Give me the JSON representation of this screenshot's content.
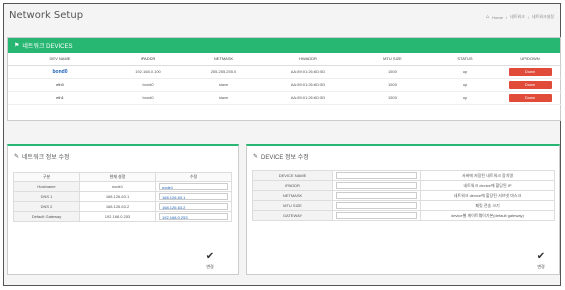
{
  "header": {
    "title": "Network Setup",
    "breadcrumb": [
      "Home",
      "네트워크",
      "네트워크설정"
    ],
    "home_icon": "home-icon"
  },
  "devices": {
    "title": "네트워크 DEVICES",
    "icon": "bookmark-icon",
    "columns": [
      "DEV NAME",
      "IPADDR",
      "NETMASK",
      "HWADDR",
      "MTU SIZE",
      "STATUS",
      "UP/DOWN"
    ],
    "rows": [
      {
        "name": "bond0",
        "ipaddr": "192.168.0.100",
        "netmask": "255.255.255.0",
        "hwaddr": "AA:89:01:26:6D:5D",
        "mtu": "1500",
        "status": "up",
        "action": "Down"
      },
      {
        "name": "eth0",
        "ipaddr": "bond0",
        "netmask": "slave",
        "hwaddr": "AA:89:01:26:6D:5D",
        "mtu": "1500",
        "status": "up",
        "action": "Down"
      },
      {
        "name": "eth1",
        "ipaddr": "bond0",
        "netmask": "slave",
        "hwaddr": "AA:89:01:26:6D:5D",
        "mtu": "1500",
        "status": "up",
        "action": "Down"
      }
    ],
    "accent_color": "#27b772",
    "down_color": "#e04b3a"
  },
  "network_edit": {
    "title": "네트워크 정보 수정",
    "icon": "edit-icon",
    "columns": [
      "구분",
      "현재 설정",
      "수정"
    ],
    "rows": [
      {
        "label": "Hostname",
        "current": "node1",
        "value": "node1"
      },
      {
        "label": "DNS 1",
        "current": "168.126.63.1",
        "value": "168.126.63.1"
      },
      {
        "label": "DNS 2",
        "current": "168.126.63.2",
        "value": "168.126.63.2"
      },
      {
        "label": "Default Gateway",
        "current": "192.168.0.253",
        "value": "192.168.0.253"
      }
    ],
    "save_label": "변경"
  },
  "device_edit": {
    "title": "DEVICE 정보 수정",
    "icon": "edit-icon",
    "rows": [
      {
        "label": "DEVICE NAME",
        "value": "",
        "desc": "서버에 저장된 네트워크 장치명"
      },
      {
        "label": "IPADDR",
        "value": "",
        "desc": "네트워크 device에 할당된 IP"
      },
      {
        "label": "NETMASK",
        "value": "",
        "desc": "네트워크 device에 할당된 서브넷 마스크"
      },
      {
        "label": "MTU SIZE",
        "value": "",
        "desc": "패킷 전송 크기"
      },
      {
        "label": "GATEWAY",
        "value": "",
        "desc": "device별 게이트웨이기본(default gateway)"
      }
    ],
    "save_label": "변경"
  }
}
